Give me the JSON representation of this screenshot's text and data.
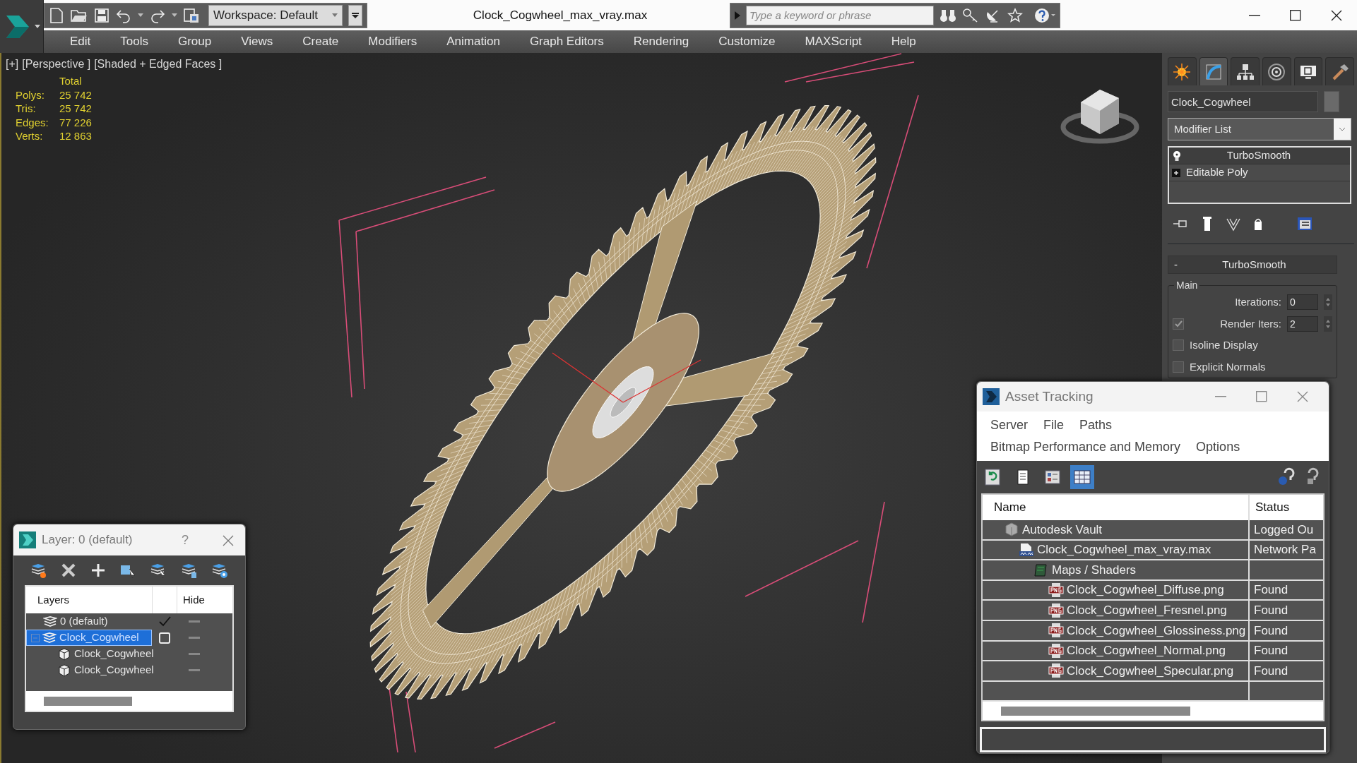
{
  "app": {
    "title": "Clock_Cogwheel_max_vray.max",
    "workspace": "Workspace: Default",
    "search_placeholder": "Type a keyword or phrase"
  },
  "menu": [
    "Edit",
    "Tools",
    "Group",
    "Views",
    "Create",
    "Modifiers",
    "Animation",
    "Graph Editors",
    "Rendering",
    "Customize",
    "MAXScript",
    "Help"
  ],
  "viewport": {
    "labels": [
      "[+]",
      "[Perspective ]",
      "[Shaded + Edged Faces ]"
    ],
    "stats_header": "Total",
    "stats": [
      {
        "label": "Polys:",
        "value": "25 742"
      },
      {
        "label": "Tris:",
        "value": "25 742"
      },
      {
        "label": "Edges:",
        "value": "77 226"
      },
      {
        "label": "Verts:",
        "value": "12 863"
      }
    ]
  },
  "command_panel": {
    "tabs": [
      {
        "kind": "create",
        "selected": false
      },
      {
        "kind": "modify",
        "selected": true
      },
      {
        "kind": "hierarchy",
        "selected": false
      },
      {
        "kind": "motion",
        "selected": false
      },
      {
        "kind": "display",
        "selected": false
      },
      {
        "kind": "utilities",
        "selected": false
      }
    ],
    "object_name": "Clock_Cogwheel",
    "modifier_list": "Modifier List",
    "stack": [
      {
        "label": "TurboSmooth",
        "kind": "modifier",
        "selected": true
      },
      {
        "label": "Editable Poly",
        "kind": "base",
        "selected": false
      }
    ],
    "rollout": {
      "collapse": "-",
      "title": "TurboSmooth",
      "group": "Main",
      "spinners": [
        {
          "label": "Iterations:",
          "value": "0"
        },
        {
          "label": "Render Iters:",
          "value": "2",
          "checked": true
        }
      ],
      "options": [
        {
          "label": "Isoline Display",
          "checked": false
        },
        {
          "label": "Explicit Normals",
          "checked": false
        }
      ]
    }
  },
  "layer_dialog": {
    "title": "Layer: 0 (default)",
    "help": "?",
    "columns": [
      "Layers",
      "Hide"
    ],
    "rows": [
      {
        "name": "0 (default)",
        "kind": "layer",
        "current": true,
        "selected": false
      },
      {
        "name": "Clock_Cogwheel",
        "kind": "layer",
        "current": false,
        "selected": true,
        "expanded": true,
        "children": [
          {
            "name": "Clock_Cogwheel",
            "kind": "object",
            "selected": false
          },
          {
            "name": "Clock_Cogwheel",
            "kind": "object",
            "selected": false
          }
        ]
      }
    ]
  },
  "asset_tracking": {
    "title": "Asset Tracking",
    "menu": [
      "Server",
      "File",
      "Paths",
      "Bitmap Performance and Memory",
      "Options"
    ],
    "toolbar": [
      {
        "kind": "refresh",
        "selected": false
      },
      {
        "kind": "list",
        "selected": false
      },
      {
        "kind": "thumbs",
        "selected": false
      },
      {
        "kind": "grid",
        "selected": true
      }
    ],
    "columns": [
      "Name",
      "Status"
    ],
    "rows": [
      {
        "name": "Autodesk Vault",
        "kind": "vault",
        "status": "Logged Ou",
        "children": [
          {
            "name": "Clock_Cogwheel_max_vray.max",
            "kind": "max",
            "status": "Network Pa",
            "children": [
              {
                "name": "Maps / Shaders",
                "kind": "maps",
                "children": [
                  {
                    "name": "Clock_Cogwheel_Diffuse.png",
                    "kind": "png",
                    "status": "Found"
                  },
                  {
                    "name": "Clock_Cogwheel_Fresnel.png",
                    "kind": "png",
                    "status": "Found"
                  },
                  {
                    "name": "Clock_Cogwheel_Glossiness.png",
                    "kind": "png",
                    "status": "Found"
                  },
                  {
                    "name": "Clock_Cogwheel_Normal.png",
                    "kind": "png",
                    "status": "Found"
                  },
                  {
                    "name": "Clock_Cogwheel_Specular.png",
                    "kind": "png",
                    "status": "Found"
                  }
                ]
              }
            ]
          }
        ]
      }
    ]
  }
}
